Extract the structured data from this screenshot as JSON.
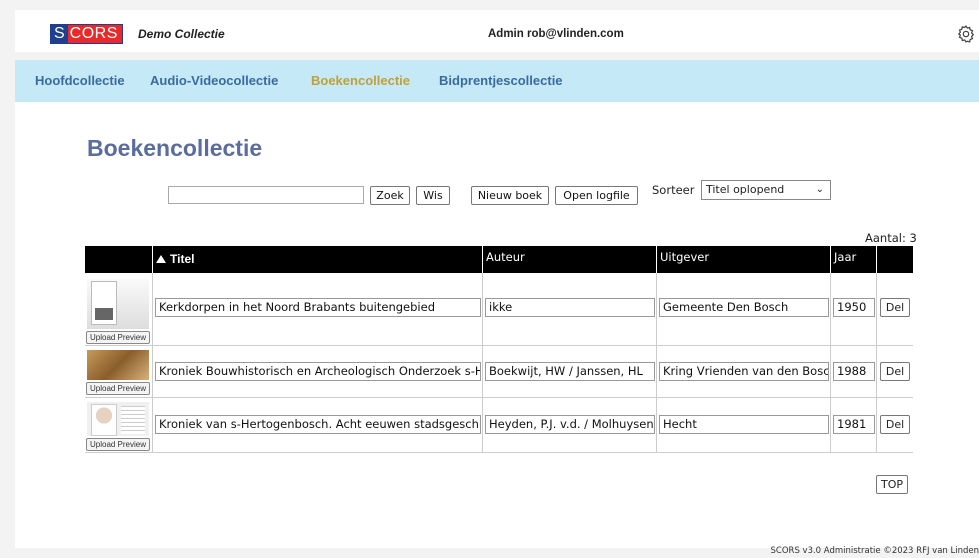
{
  "header": {
    "logo_s": "S",
    "logo_cors": "CORS",
    "app_name": "Demo Collectie",
    "admin": "Admin rob@vlinden.com",
    "settings_icon": "gear-icon"
  },
  "nav": {
    "items": [
      {
        "label": "Hoofdcollectie"
      },
      {
        "label": "Audio-Videocollectie"
      },
      {
        "label": "Boekencollectie",
        "active": true
      },
      {
        "label": "Bidprentjescollectie"
      }
    ]
  },
  "main": {
    "title": "Boekencollectie",
    "search": {
      "value": "",
      "placeholder": ""
    },
    "buttons": {
      "zoek": "Zoek",
      "wis": "Wis",
      "nieuw": "Nieuw boek",
      "logfile": "Open logfile"
    },
    "sort": {
      "label": "Sorteer",
      "selected": "Titel oplopend"
    },
    "count": "Aantal: 3",
    "table": {
      "columns": [
        "Titel",
        "Auteur",
        "Uitgever",
        "Jaar"
      ],
      "upload_label": "Upload Preview",
      "del_label": "Del",
      "rows": [
        {
          "titel": "Kerkdorpen in het Noord Brabants buitengebied",
          "auteur": "ikke",
          "uitgever": "Gemeente Den Bosch",
          "jaar": "1950"
        },
        {
          "titel": "Kroniek Bouwhistorisch en Archeologisch Onderzoek s-Hertogenbosch",
          "auteur": "Boekwijt, HW / Janssen, HL",
          "uitgever": "Kring Vrienden van den Bosch",
          "jaar": "1988"
        },
        {
          "titel": "Kroniek van s-Hertogenbosch. Acht eeuwen stadsgeschiedenis",
          "auteur": "Heyden, P.J. v.d. / Molhuysen",
          "uitgever": "Hecht",
          "jaar": "1981"
        }
      ]
    },
    "top_label": "TOP"
  },
  "footer": "SCORS v3.0 Administratie ©2023 RFJ van Linden",
  "colors": {
    "nav_bg": "#c5e9f6",
    "nav_link": "#3b6aa0",
    "nav_active": "#bfa13a",
    "title": "#5a6d9e",
    "logo_blue": "#1f3f8f",
    "logo_red": "#ea2a2a"
  }
}
